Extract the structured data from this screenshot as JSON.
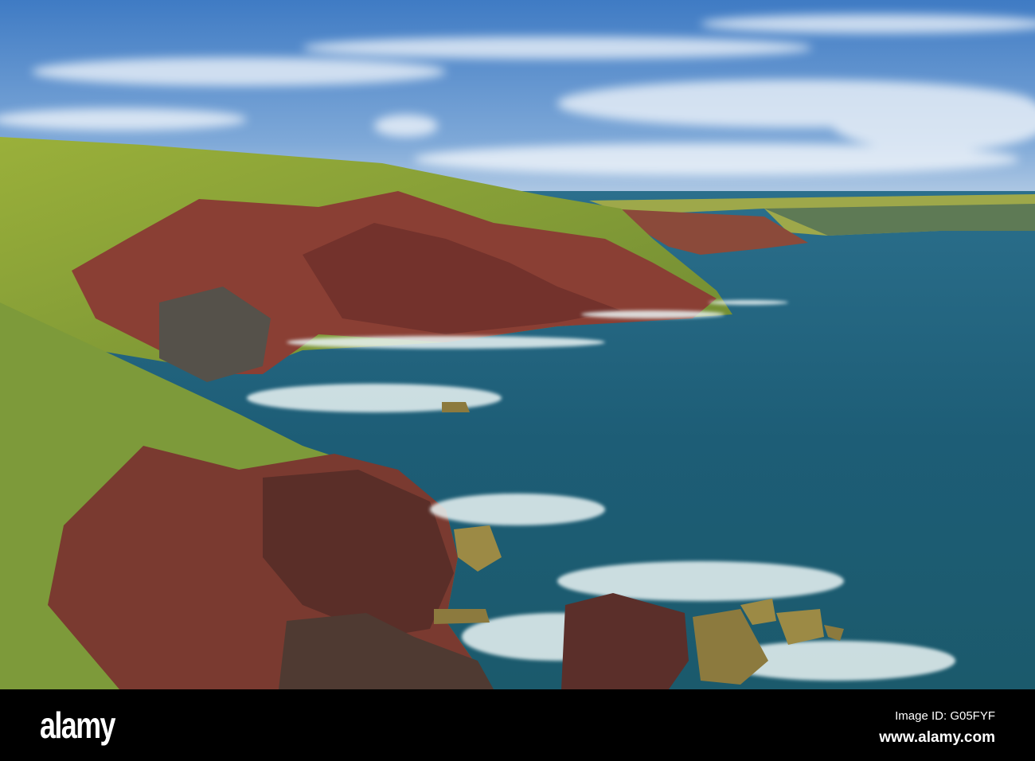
{
  "photo": {
    "subject": "coastal cliffs and sea",
    "colors": {
      "sky": "#4f86c6",
      "sea": "#1f5f78",
      "grass": "#8aa83a",
      "rock": "#7a3a30",
      "foam": "#e6f2f2"
    }
  },
  "footer": {
    "logo": "alamy",
    "image_id": "Image ID: G05FYF",
    "website": "www.alamy.com"
  }
}
